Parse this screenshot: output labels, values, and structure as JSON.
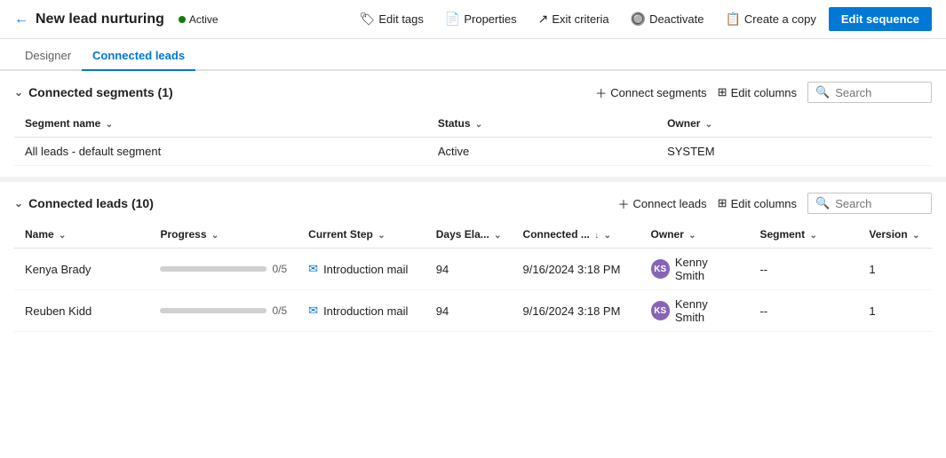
{
  "header": {
    "back_label": "←",
    "title": "New lead nurturing",
    "status": "Active",
    "actions": [
      {
        "id": "edit-tags",
        "label": "Edit tags",
        "icon": "🏷"
      },
      {
        "id": "properties",
        "label": "Properties",
        "icon": "📄"
      },
      {
        "id": "exit-criteria",
        "label": "Exit criteria",
        "icon": "↗"
      },
      {
        "id": "deactivate",
        "label": "Deactivate",
        "icon": "🔘"
      },
      {
        "id": "create-copy",
        "label": "Create a copy",
        "icon": "📋"
      }
    ],
    "edit_seq_label": "Edit sequence"
  },
  "tabs": [
    {
      "id": "designer",
      "label": "Designer"
    },
    {
      "id": "connected-leads",
      "label": "Connected leads",
      "active": true
    }
  ],
  "segments_section": {
    "title": "Connected segments (1)",
    "connect_btn": "Connect segments",
    "edit_columns_btn": "Edit columns",
    "search_placeholder": "Search",
    "columns": [
      {
        "id": "segment-name",
        "label": "Segment name"
      },
      {
        "id": "status",
        "label": "Status"
      },
      {
        "id": "owner",
        "label": "Owner"
      }
    ],
    "rows": [
      {
        "segment_name": "All leads - default segment",
        "status": "Active",
        "owner": "SYSTEM"
      }
    ]
  },
  "leads_section": {
    "title": "Connected leads (10)",
    "connect_btn": "Connect leads",
    "edit_columns_btn": "Edit columns",
    "search_placeholder": "Search",
    "columns": [
      {
        "id": "name",
        "label": "Name"
      },
      {
        "id": "progress",
        "label": "Progress"
      },
      {
        "id": "current-step",
        "label": "Current Step"
      },
      {
        "id": "days-elapsed",
        "label": "Days Ela..."
      },
      {
        "id": "connected",
        "label": "Connected ..."
      },
      {
        "id": "owner",
        "label": "Owner"
      },
      {
        "id": "segment",
        "label": "Segment"
      },
      {
        "id": "version",
        "label": "Version"
      }
    ],
    "rows": [
      {
        "name": "Kenya Brady",
        "progress": "0/5",
        "progress_pct": 0,
        "current_step": "Introduction mail",
        "days_elapsed": "94",
        "connected_date": "9/16/2024 3:18 PM",
        "owner_initials": "KS",
        "owner_name": "Kenny Smith",
        "segment": "--",
        "version": "1"
      },
      {
        "name": "Reuben Kidd",
        "progress": "0/5",
        "progress_pct": 0,
        "current_step": "Introduction mail",
        "days_elapsed": "94",
        "connected_date": "9/16/2024 3:18 PM",
        "owner_initials": "KS",
        "owner_name": "Kenny Smith",
        "segment": "--",
        "version": "1"
      }
    ]
  }
}
